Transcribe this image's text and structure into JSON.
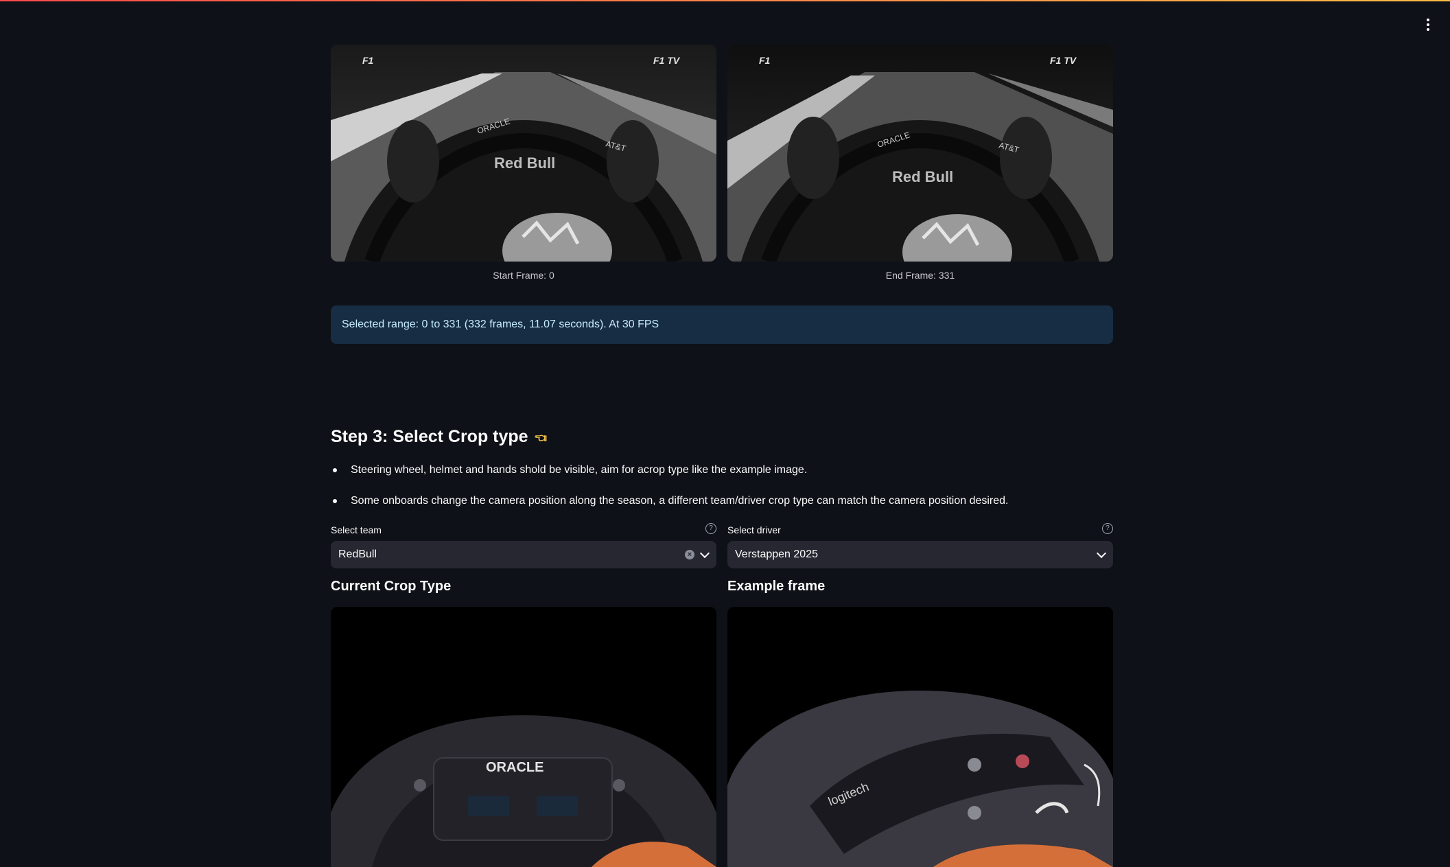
{
  "frames": {
    "start_caption": "Start Frame: 0",
    "end_caption": "End Frame: 331",
    "overlay_left": "F1",
    "overlay_right": "F1 TV"
  },
  "info": {
    "message": "Selected range: 0 to 331 (332 frames, 11.07 seconds). At 30 FPS"
  },
  "step3": {
    "title": "Step 3: Select Crop type",
    "icon": "pointing-hand-icon",
    "bullets": [
      "Steering wheel, helmet and hands shold be visible, aim for acrop type like the example image.",
      "Some onboards change the camera position along the season, a different team/driver crop type can match the camera position desired."
    ]
  },
  "team_select": {
    "label": "Select team",
    "value": "RedBull"
  },
  "driver_select": {
    "label": "Select driver",
    "value": "Verstappen 2025"
  },
  "crop_section": {
    "current_title": "Current Crop Type",
    "example_title": "Example frame",
    "current_brand": "ORACLE",
    "example_brand": "logitech"
  },
  "colors": {
    "background": "#0e1117",
    "info_bg": "#172d43",
    "info_text": "#c7ebff",
    "select_bg": "#262730"
  }
}
